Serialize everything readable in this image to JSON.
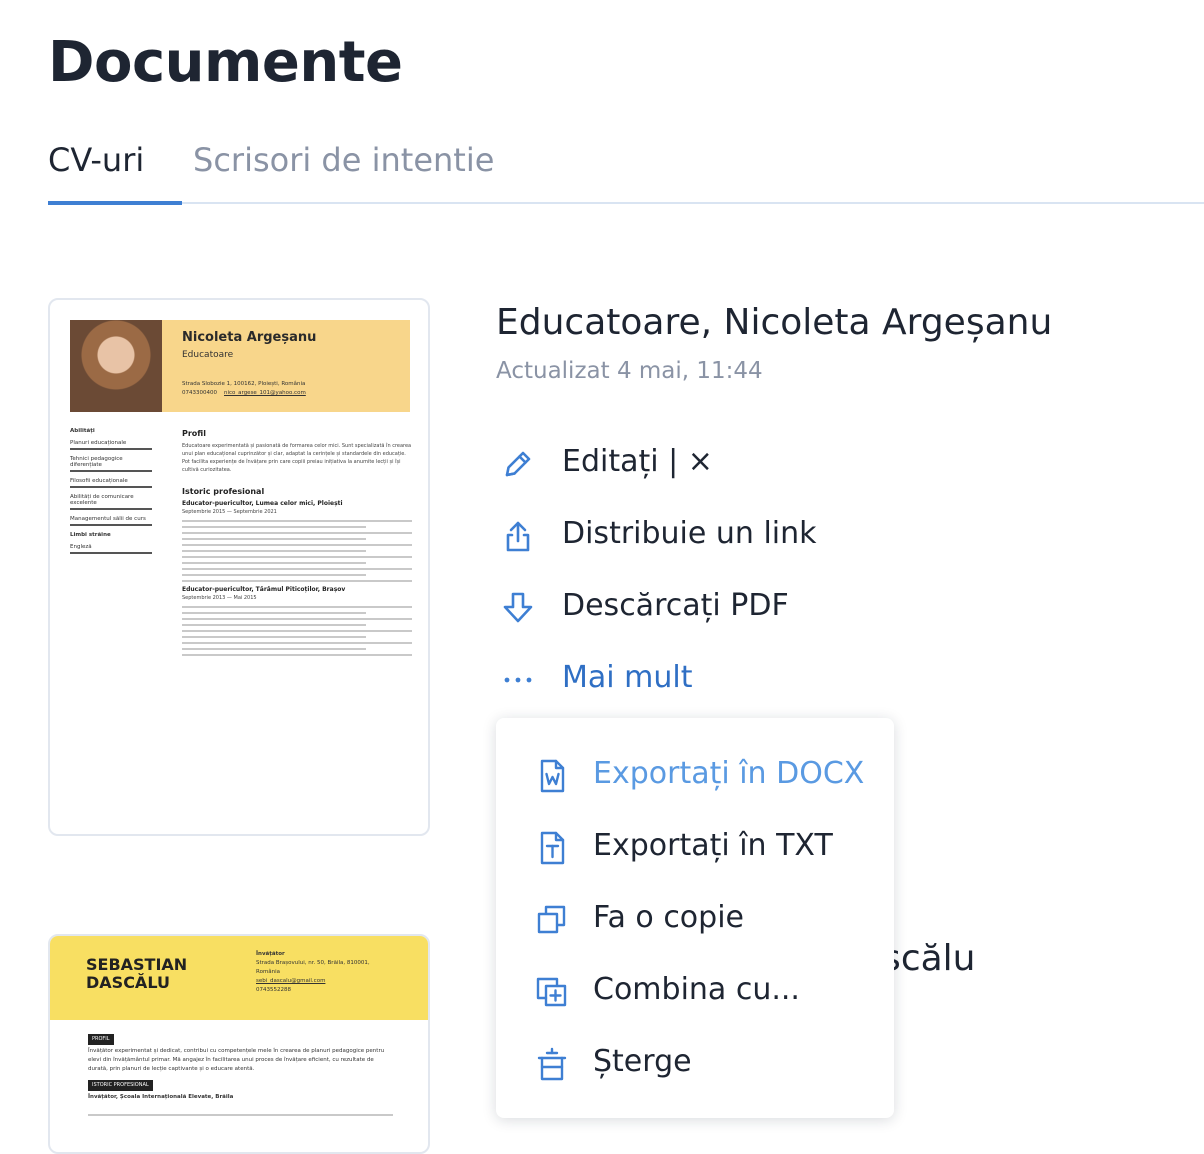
{
  "page": {
    "title": "Documente"
  },
  "tabs": [
    {
      "label": "CV-uri",
      "active": true
    },
    {
      "label": "Scrisori de intentie",
      "active": false
    }
  ],
  "colors": {
    "accent": "#3e7fd3",
    "text": "#1e2532",
    "muted": "#8a93a5",
    "link": "#2f6fc4"
  },
  "resume1": {
    "name": "Nicoleta Argeșanu",
    "role": "Educatoare",
    "address": "Strada Slobozie 1, 100162, Ploiești, România",
    "phone": "0743300400",
    "email": "nico_argese_101@yahoo.com",
    "skills_heading": "Abilități",
    "skills": [
      "Planuri educaționale",
      "Tehnici pedagogice diferențiate",
      "Filosofii educaționale",
      "Abilități de comunicare excelente",
      "Managementul sălii de curs"
    ],
    "languages_heading": "Limbi străine",
    "language": "Engleză",
    "profile_heading": "Profil",
    "profile_text": "Educatoare experimentată și pasionată de formarea celor mici. Sunt specializată în crearea unui plan educațional cuprinzător și clar, adaptat la cerințele și standardele din educație. Pot facilita experiențe de învățare prin care copiii preiau inițiativa la anumite lecții și își cultivă curiozitatea.",
    "history_heading": "Istoric profesional",
    "job1_title": "Educator-puericultor, Lumea celor mici, Ploiești",
    "job1_dates": "Septembrie 2015 — Septembrie 2021",
    "job2_title": "Educator-puericultor, Tărâmul Piticoților, Brașov",
    "job2_dates": "Septembrie 2013 — Mai 2015"
  },
  "resume2": {
    "name": "SEBASTIAN\nDASCĂLU",
    "role": "Învățător",
    "address": "Strada Brașovului, nr. 50, Brăila, 810001, România",
    "email": "sebi_dascalu@gmail.com",
    "phone": "0743552288",
    "profile_tag": "PROFIL",
    "profile_text": "Învățător experimentat și dedicat, contribui cu competențele mele în crearea de planuri pedagogice pentru elevi din învățământul primar. Mă angajez în facilitarea unui proces de învățare eficient, cu rezultate de durată, prin planuri de lecție captivante și o educare atentă.",
    "history_tag": "ISTORIC PROFESIONAL",
    "job1_title": "Învățător, Școala Internațională Elevate, Brăila"
  },
  "document": {
    "title": "Educatoare, Nicoleta Argeșanu",
    "updated": "Actualizat 4 mai, 11:44"
  },
  "actions": {
    "edit": "Editați | ×",
    "share": "Distribuie un link",
    "download_pdf": "Descărcați PDF",
    "more": "Mai mult"
  },
  "menu": {
    "export_docx": "Exportați în DOCX",
    "export_txt": "Exportați în TXT",
    "copy": "Fa o copie",
    "combine": "Combina cu...",
    "delete": "Șterge"
  },
  "second_document": {
    "title_visible_part": "ascălu"
  },
  "icons": {
    "edit": "pencil-icon",
    "share": "share-icon",
    "download": "download-arrow-icon",
    "more": "ellipsis-icon",
    "docx": "word-file-icon",
    "txt": "text-file-icon",
    "copy": "copy-icon",
    "combine": "combine-icon",
    "delete": "trash-icon"
  }
}
